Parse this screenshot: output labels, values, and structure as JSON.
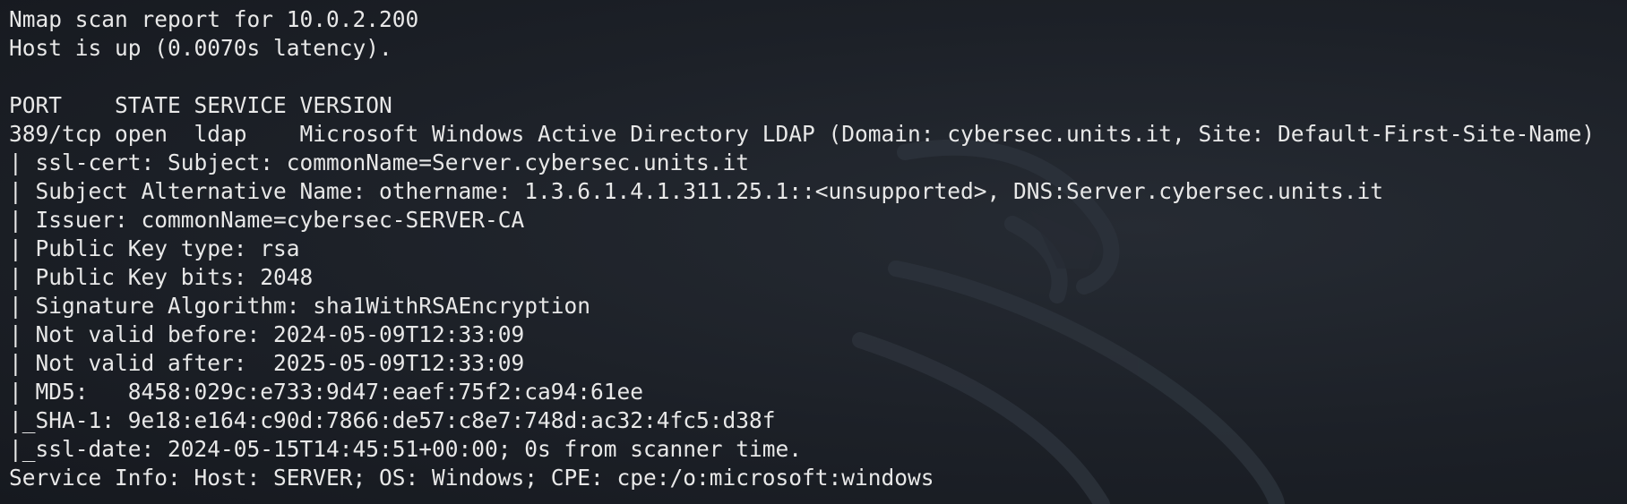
{
  "terminal": {
    "lines": [
      "Nmap scan report for 10.0.2.200",
      "Host is up (0.0070s latency).",
      "",
      "PORT    STATE SERVICE VERSION",
      "389/tcp open  ldap    Microsoft Windows Active Directory LDAP (Domain: cybersec.units.it, Site: Default-First-Site-Name)",
      "| ssl-cert: Subject: commonName=Server.cybersec.units.it",
      "| Subject Alternative Name: othername: 1.3.6.1.4.1.311.25.1::<unsupported>, DNS:Server.cybersec.units.it",
      "| Issuer: commonName=cybersec-SERVER-CA",
      "| Public Key type: rsa",
      "| Public Key bits: 2048",
      "| Signature Algorithm: sha1WithRSAEncryption",
      "| Not valid before: 2024-05-09T12:33:09",
      "| Not valid after:  2025-05-09T12:33:09",
      "| MD5:   8458:029c:e733:9d47:eaef:75f2:ca94:61ee",
      "|_SHA-1: 9e18:e164:c90d:7866:de57:c8e7:748d:ac32:4fc5:d38f",
      "|_ssl-date: 2024-05-15T14:45:51+00:00; 0s from scanner time.",
      "Service Info: Host: SERVER; OS: Windows; CPE: cpe:/o:microsoft:windows"
    ],
    "colors": {
      "background": "#1c2027",
      "text": "#e8e8e8"
    },
    "watermark_icon": "kali-dragon-icon"
  }
}
